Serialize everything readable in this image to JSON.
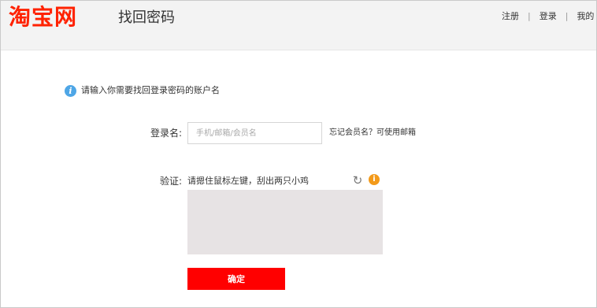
{
  "header": {
    "logo_text": "淘宝网",
    "page_title": "找回密码",
    "nav": {
      "register": "注册",
      "login": "登录",
      "my_taobao": "我的 淘"
    }
  },
  "form": {
    "hint": "请输入你需要找回登录密码的账户名",
    "account_label": "登录名:",
    "account_placeholder": "手机/邮箱/会员名",
    "forgot_link": "忘记会员名？可使用邮箱",
    "captcha_label": "验证:",
    "captcha_instruction": "请摁住鼠标左键，刮出两只小鸡",
    "submit_label": "确定"
  },
  "icons": {
    "info": "info-icon",
    "refresh": "refresh-icon",
    "warning": "info-icon-orange"
  },
  "colors": {
    "brand": "#ff2200",
    "button": "#ff0000",
    "info": "#4ea6e6",
    "warning": "#f39a1a"
  }
}
